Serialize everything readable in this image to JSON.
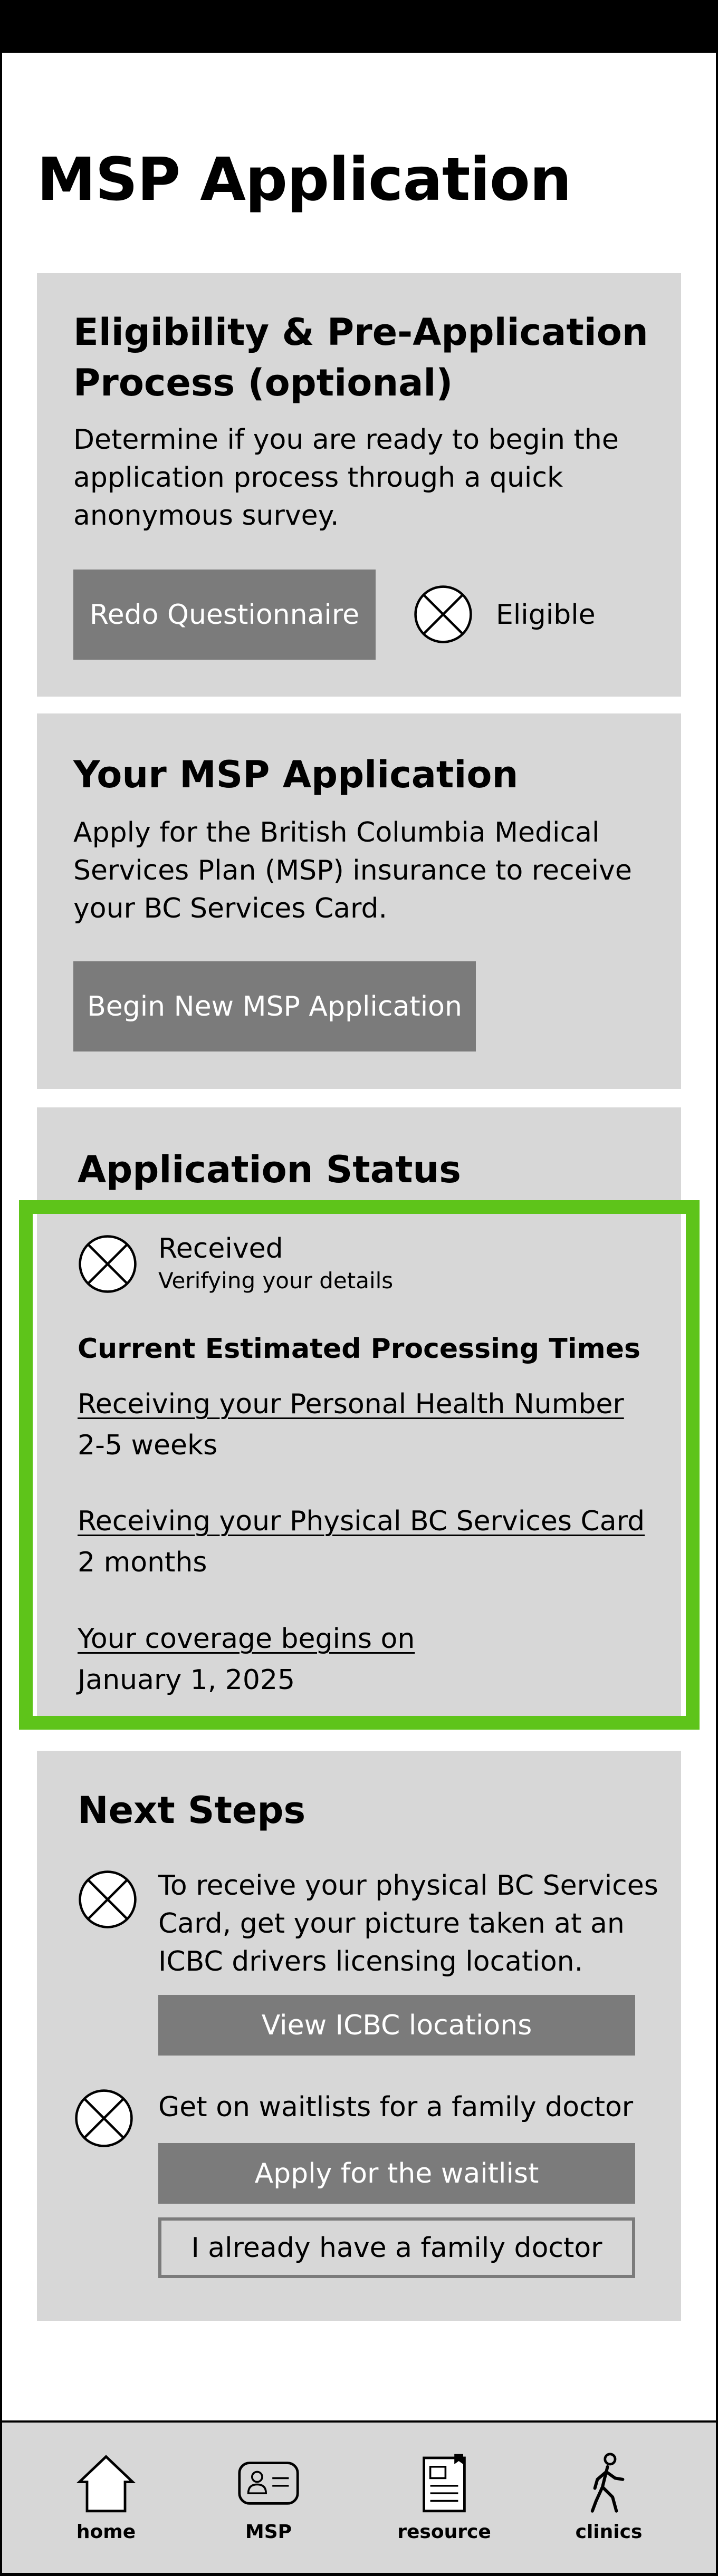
{
  "header": {
    "title": "MSP Application"
  },
  "eligibility": {
    "title_line1": "Eligibility & Pre-Application",
    "title_line2": "Process (optional)",
    "desc_line1": "Determine if you are ready to begin the",
    "desc_line2": "application process through a quick",
    "desc_line3": "anonymous survey.",
    "redo_button": "Redo Questionnaire",
    "status_label": "Eligible"
  },
  "application": {
    "title": "Your MSP Application",
    "desc_line1": "Apply for the British Columbia Medical",
    "desc_line2": "Services Plan (MSP) insurance to receive",
    "desc_line3": "your BC Services Card.",
    "begin_button": "Begin New MSP Application"
  },
  "status": {
    "title": "Application Status",
    "state": "Received",
    "state_detail": "Verifying your details",
    "processing_heading": "Current Estimated Processing Times",
    "items": [
      {
        "label": "Receiving your Personal Health Number",
        "value": "2-5 weeks"
      },
      {
        "label": "Receiving your Physical BC Services Card",
        "value": "2 months"
      },
      {
        "label": "Your coverage begins on",
        "value": "January 1, 2025"
      }
    ]
  },
  "next_steps": {
    "title": "Next Steps",
    "step1_line1": "To receive your physical BC Services",
    "step1_line2": "Card, get your picture taken at an",
    "step1_line3": "ICBC drivers licensing location.",
    "icbc_button": "View ICBC locations",
    "step2_text": "Get on waitlists for a family doctor",
    "waitlist_button": "Apply for the waitlist",
    "have_doctor_button": "I already have a family doctor"
  },
  "nav": {
    "items": [
      {
        "label": "home",
        "icon": "house-icon"
      },
      {
        "label": "MSP",
        "icon": "id-card-icon"
      },
      {
        "label": "resource",
        "icon": "document-icon"
      },
      {
        "label": "clinics",
        "icon": "walking-person-icon"
      }
    ]
  },
  "colors": {
    "card_bg": "#d7d7d7",
    "button_bg": "#7b7b7b",
    "highlight": "#5ec41a"
  }
}
